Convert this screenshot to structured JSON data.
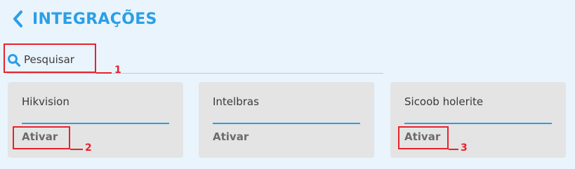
{
  "header": {
    "title": "INTEGRAÇÕES",
    "back_icon": "chevron-left-icon"
  },
  "search": {
    "placeholder": "Pesquisar",
    "value": "",
    "icon": "search-icon"
  },
  "integrations": [
    {
      "name": "Hikvision",
      "action_label": "Ativar"
    },
    {
      "name": "Intelbras",
      "action_label": "Ativar"
    },
    {
      "name": "Sicoob holerite",
      "action_label": "Ativar"
    }
  ],
  "annotations": [
    {
      "number": "1"
    },
    {
      "number": "2"
    },
    {
      "number": "3"
    }
  ],
  "colors": {
    "accent": "#2a9fe6",
    "background": "#eaf4fd",
    "card": "#e4e4e4",
    "annotation": "#e8222d"
  }
}
